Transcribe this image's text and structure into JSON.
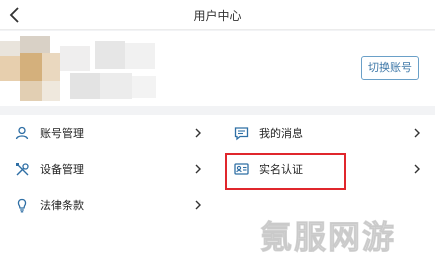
{
  "header": {
    "title": "用户中心",
    "back_icon": "chevron-left-icon"
  },
  "profile": {
    "switch_account_label": "切换账号"
  },
  "menu": {
    "left": [
      {
        "label": "账号管理",
        "icon": "person-icon"
      },
      {
        "label": "设备管理",
        "icon": "tools-icon"
      },
      {
        "label": "法律条款",
        "icon": "lightbulb-icon"
      }
    ],
    "right": [
      {
        "label": "我的消息",
        "icon": "message-icon"
      },
      {
        "label": "实名认证",
        "icon": "id-card-icon",
        "highlighted": true
      }
    ]
  },
  "watermark": {
    "text": "氪服网游"
  },
  "colors": {
    "icon": "#2f6fa5",
    "highlight": "#e0262c",
    "button_border": "#6aa0c8"
  }
}
